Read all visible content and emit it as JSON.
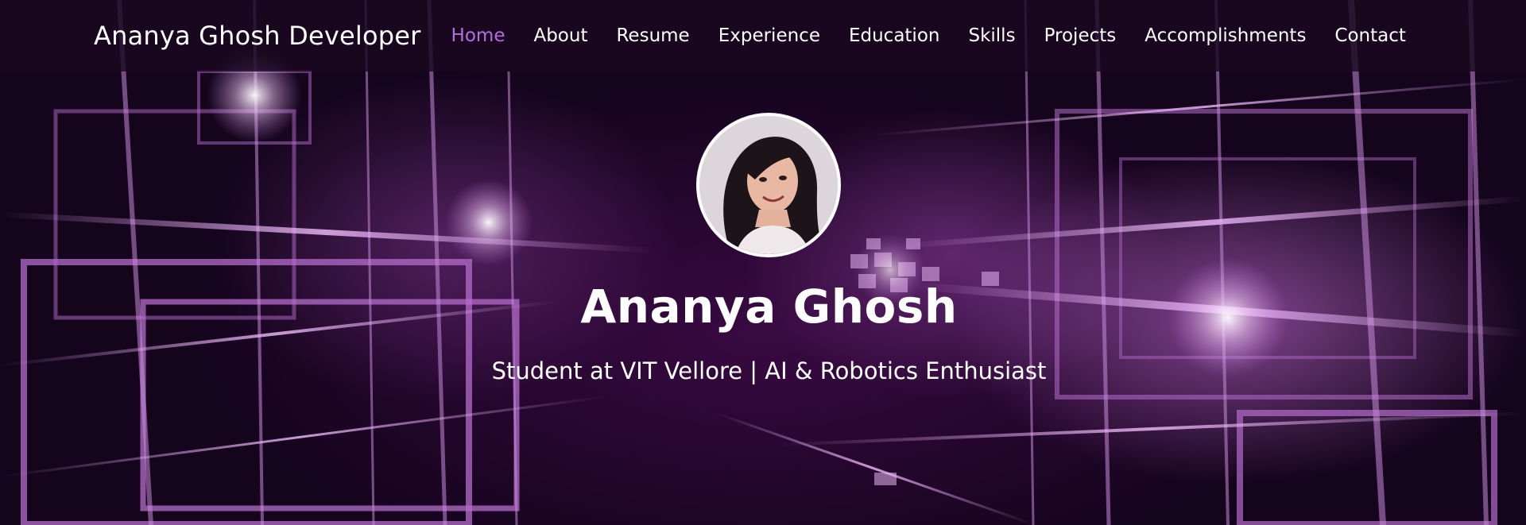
{
  "navbar": {
    "brand": "Ananya Ghosh Developer",
    "links": [
      {
        "label": "Home",
        "active": true
      },
      {
        "label": "About",
        "active": false
      },
      {
        "label": "Resume",
        "active": false
      },
      {
        "label": "Experience",
        "active": false
      },
      {
        "label": "Education",
        "active": false
      },
      {
        "label": "Skills",
        "active": false
      },
      {
        "label": "Projects",
        "active": false
      },
      {
        "label": "Accomplishments",
        "active": false
      },
      {
        "label": "Contact",
        "active": false
      }
    ]
  },
  "hero": {
    "name": "Ananya Ghosh",
    "tagline": "Student at VIT Vellore | AI & Robotics Enthusiast",
    "avatar_icon": "profile-photo"
  },
  "colors": {
    "accent": "#b56ee0",
    "text": "#ffffff",
    "navbar_bg": "#1a0820",
    "background": "#2a0a33"
  }
}
